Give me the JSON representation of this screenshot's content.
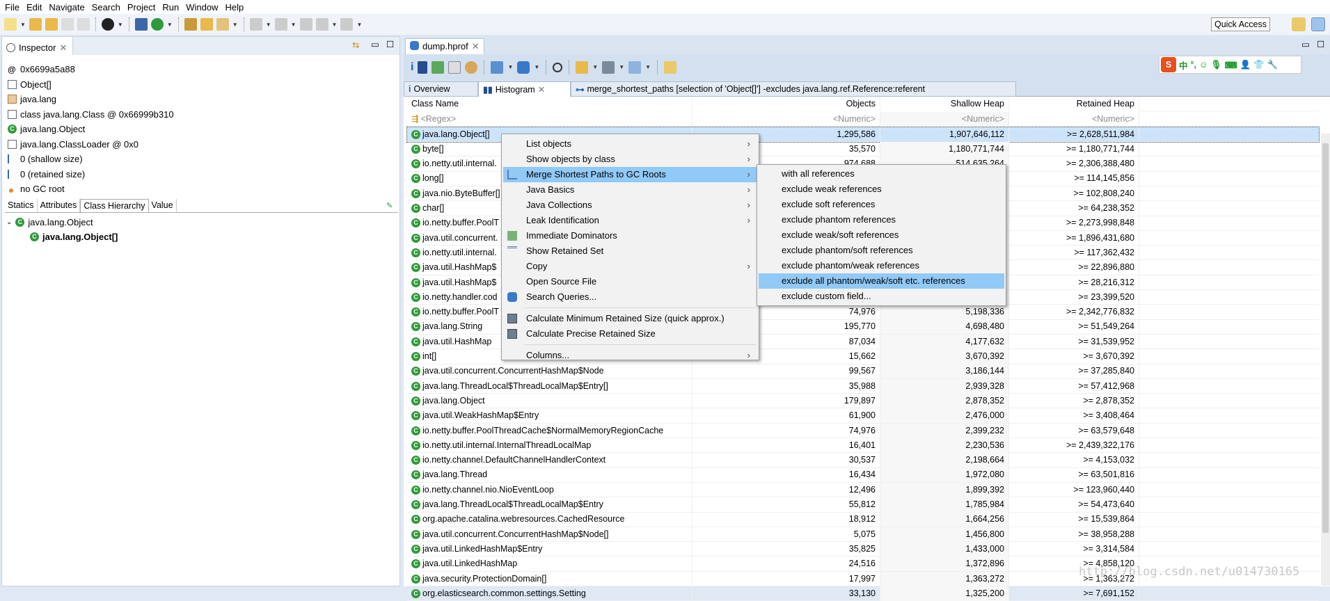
{
  "menubar": [
    "File",
    "Edit",
    "Navigate",
    "Search",
    "Project",
    "Run",
    "Window",
    "Help"
  ],
  "quick_access": "Quick Access",
  "inspector": {
    "tab": "Inspector",
    "items": [
      {
        "icon": "address-icon",
        "text": "0x6699a5a88"
      },
      {
        "icon": "class-file-icon",
        "text": "Object[]"
      },
      {
        "icon": "package-icon",
        "text": "java.lang"
      },
      {
        "icon": "class-object-icon",
        "text": "class java.lang.Class @ 0x66999b310"
      },
      {
        "icon": "superclass-icon",
        "text": "java.lang.Object"
      },
      {
        "icon": "classloader-icon",
        "text": "java.lang.ClassLoader @ 0x0"
      },
      {
        "icon": "size-icon",
        "text": "0 (shallow size)"
      },
      {
        "icon": "size-icon",
        "text": "0 (retained size)"
      },
      {
        "icon": "gc-root-icon",
        "text": "no GC root"
      }
    ],
    "subtabs": [
      "Statics",
      "Attributes",
      "Class Hierarchy",
      "Value"
    ],
    "active_subtab": "Class Hierarchy",
    "hierarchy": [
      "java.lang.Object",
      "java.lang.Object[]"
    ]
  },
  "editor": {
    "tab": "dump.hprof",
    "subtabs": [
      "Overview",
      "Histogram",
      "merge_shortest_paths [selection of 'Object[]'] -excludes java.lang.ref.Reference:referent"
    ],
    "active_subtab": "Histogram",
    "columns": [
      "Class Name",
      "Objects",
      "Shallow Heap",
      "Retained Heap"
    ],
    "filters": [
      "<Regex>",
      "<Numeric>",
      "<Numeric>",
      "<Numeric>"
    ],
    "rows": [
      [
        "java.lang.Object[]",
        "1,295,586",
        "1,907,646,112",
        ">= 2,628,511,984"
      ],
      [
        "byte[]",
        "35,570",
        "1,180,771,744",
        ">= 1,180,771,744"
      ],
      [
        "io.netty.util.internal.",
        "974,688",
        "514,635,264",
        ">= 2,306,388,480"
      ],
      [
        "long[]",
        "",
        "",
        ">= 114,145,856"
      ],
      [
        "java.nio.ByteBuffer[]",
        "",
        "",
        ">= 102,808,240"
      ],
      [
        "char[]",
        "",
        "",
        ">= 64,238,352"
      ],
      [
        "io.netty.buffer.PoolT",
        "",
        "",
        ">= 2,273,998,848"
      ],
      [
        "java.util.concurrent.",
        "",
        "",
        ">= 1,896,431,680"
      ],
      [
        "io.netty.util.internal.",
        "",
        "",
        ">= 117,362,432"
      ],
      [
        "java.util.HashMap$",
        "",
        "",
        ">= 22,896,880"
      ],
      [
        "java.util.HashMap$",
        "",
        "",
        ">= 28,216,312"
      ],
      [
        "io.netty.handler.cod",
        "",
        "",
        ">= 23,399,520"
      ],
      [
        "io.netty.buffer.PoolT",
        "74,976",
        "5,198,336",
        ">= 2,342,776,832"
      ],
      [
        "java.lang.String",
        "195,770",
        "4,698,480",
        ">= 51,549,264"
      ],
      [
        "java.util.HashMap",
        "87,034",
        "4,177,632",
        ">= 31,539,952"
      ],
      [
        "int[]",
        "15,662",
        "3,670,392",
        ">= 3,670,392"
      ],
      [
        "java.util.concurrent.ConcurrentHashMap$Node",
        "99,567",
        "3,186,144",
        ">= 37,285,840"
      ],
      [
        "java.lang.ThreadLocal$ThreadLocalMap$Entry[]",
        "35,988",
        "2,939,328",
        ">= 57,412,968"
      ],
      [
        "java.lang.Object",
        "179,897",
        "2,878,352",
        ">= 2,878,352"
      ],
      [
        "java.util.WeakHashMap$Entry",
        "61,900",
        "2,476,000",
        ">= 3,408,464"
      ],
      [
        "io.netty.buffer.PoolThreadCache$NormalMemoryRegionCache",
        "74,976",
        "2,399,232",
        ">= 63,579,648"
      ],
      [
        "io.netty.util.internal.InternalThreadLocalMap",
        "16,401",
        "2,230,536",
        ">= 2,439,322,176"
      ],
      [
        "io.netty.channel.DefaultChannelHandlerContext",
        "30,537",
        "2,198,664",
        ">= 4,153,032"
      ],
      [
        "java.lang.Thread",
        "16,434",
        "1,972,080",
        ">= 63,501,816"
      ],
      [
        "io.netty.channel.nio.NioEventLoop",
        "12,496",
        "1,899,392",
        ">= 123,960,440"
      ],
      [
        "java.lang.ThreadLocal$ThreadLocalMap$Entry",
        "55,812",
        "1,785,984",
        ">= 54,473,640"
      ],
      [
        "org.apache.catalina.webresources.CachedResource",
        "18,912",
        "1,664,256",
        ">= 15,539,864"
      ],
      [
        "java.util.concurrent.ConcurrentHashMap$Node[]",
        "5,075",
        "1,456,800",
        ">= 38,958,288"
      ],
      [
        "java.util.LinkedHashMap$Entry",
        "35,825",
        "1,433,000",
        ">= 3,314,584"
      ],
      [
        "java.util.LinkedHashMap",
        "24,516",
        "1,372,896",
        ">= 4,858,120"
      ],
      [
        "java.security.ProtectionDomain[]",
        "17,997",
        "1,363,272",
        ">= 1,363,272"
      ],
      [
        "org.elasticsearch.common.settings.Setting",
        "33,130",
        "1,325,200",
        ">= 7,691,152"
      ]
    ],
    "selected_row": 0
  },
  "context_menu": {
    "items": [
      {
        "label": "List objects",
        "submenu": true
      },
      {
        "label": "Show objects by class",
        "submenu": true
      },
      {
        "label": "Merge Shortest Paths to GC Roots",
        "submenu": true,
        "highlighted": true,
        "icon": "merge-paths-icon"
      },
      {
        "label": "Java Basics",
        "submenu": true
      },
      {
        "label": "Java Collections",
        "submenu": true
      },
      {
        "label": "Leak Identification",
        "submenu": true
      },
      {
        "label": "Immediate Dominators",
        "icon": "dominators-icon"
      },
      {
        "label": "Show Retained Set",
        "icon": "retained-set-icon"
      },
      {
        "label": "Copy",
        "submenu": true
      },
      {
        "label": "Open Source File"
      },
      {
        "label": "Search Queries...",
        "icon": "search-queries-icon"
      },
      {
        "separator": true
      },
      {
        "label": "Calculate Minimum Retained Size (quick approx.)",
        "icon": "calculator-icon"
      },
      {
        "label": "Calculate Precise Retained Size",
        "icon": "calculator-icon"
      },
      {
        "separator": true
      },
      {
        "label": "Columns...",
        "submenu": true
      }
    ],
    "submenu": [
      "with all references",
      "exclude weak references",
      "exclude soft references",
      "exclude phantom references",
      "exclude weak/soft references",
      "exclude phantom/soft references",
      "exclude phantom/weak references",
      "exclude all phantom/weak/soft etc. references",
      "exclude custom field..."
    ],
    "submenu_highlighted": 7
  },
  "ime_toolbar": {
    "brand": "S",
    "items": [
      "中",
      "°,"
    ]
  },
  "watermark": "http://blog.csdn.net/u014730165",
  "colors": {
    "highlight": "#91c9f7",
    "selection": "#cce4fa",
    "class_icon": "#2f9a3a",
    "panel_bg": "#d3e0ef"
  }
}
